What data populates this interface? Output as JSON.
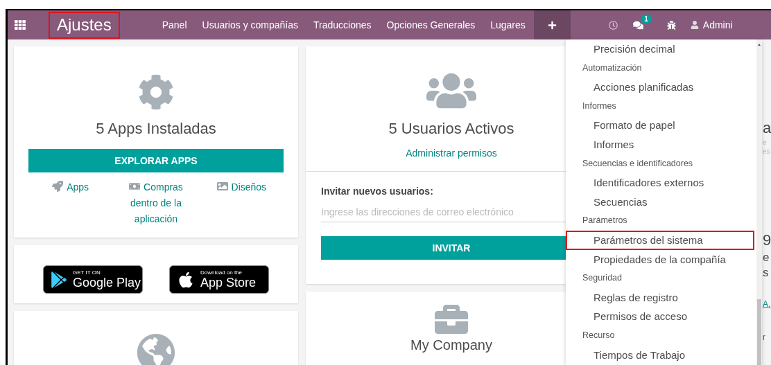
{
  "navbar": {
    "brand": {
      "label": "Ajustes",
      "highlighted": true
    },
    "menu": [
      {
        "label": "Panel"
      },
      {
        "label": "Usuarios y compañías"
      },
      {
        "label": "Traducciones"
      },
      {
        "label": "Opciones Generales"
      },
      {
        "label": "Lugares"
      }
    ],
    "add_menu_open": true,
    "messages_badge": "1",
    "user": "Admini"
  },
  "apps_card": {
    "title": "5 Apps Instaladas",
    "button": "EXPLORAR APPS",
    "links": [
      {
        "kind": "rocket",
        "label": "Apps"
      },
      {
        "kind": "money",
        "label": "Compras dentro de la aplicación"
      },
      {
        "kind": "image",
        "label": "Diseños"
      }
    ]
  },
  "store_card": {
    "google": {
      "top": "GET IT ON",
      "bottom": "Google Play"
    },
    "apple": {
      "top": "Download on the",
      "bottom": "App Store"
    }
  },
  "users_card": {
    "title": "5 Usuarios Activos",
    "link": "Administrar permisos",
    "invite_label": "Invitar nuevos usuarios:",
    "invite_placeholder": "Ingrese las direcciones de correo electrónico",
    "invite_button": "INVITAR"
  },
  "company_card": {
    "title": "My Company"
  },
  "right_column": [
    {
      "kind": "heading",
      "text": "a"
    },
    {
      "kind": "small",
      "text": "e"
    },
    {
      "kind": "small",
      "text": "es"
    },
    {
      "kind": "stat",
      "text": "9"
    },
    {
      "kind": "line",
      "text": "e"
    },
    {
      "kind": "line",
      "text": "s"
    },
    {
      "kind": "link",
      "text": "A."
    },
    {
      "kind": "link2",
      "text": "r"
    }
  ],
  "dropdown": [
    {
      "kind": "item",
      "label": "Precisión decimal",
      "highlighted": false
    },
    {
      "kind": "header",
      "label": "Automatización"
    },
    {
      "kind": "item",
      "label": "Acciones planificadas",
      "highlighted": false
    },
    {
      "kind": "header",
      "label": "Informes"
    },
    {
      "kind": "item",
      "label": "Formato de papel",
      "highlighted": false
    },
    {
      "kind": "item",
      "label": "Informes",
      "highlighted": false
    },
    {
      "kind": "header",
      "label": "Secuencias e identificadores"
    },
    {
      "kind": "item",
      "label": "Identificadores externos",
      "highlighted": false
    },
    {
      "kind": "item",
      "label": "Secuencias",
      "highlighted": false
    },
    {
      "kind": "header",
      "label": "Parámetros"
    },
    {
      "kind": "item",
      "label": "Parámetros del sistema",
      "highlighted": true
    },
    {
      "kind": "item",
      "label": "Propiedades de la compañía",
      "highlighted": false
    },
    {
      "kind": "header",
      "label": "Seguridad"
    },
    {
      "kind": "item",
      "label": "Reglas de registro",
      "highlighted": false
    },
    {
      "kind": "item",
      "label": "Permisos de acceso",
      "highlighted": false
    },
    {
      "kind": "header",
      "label": "Recurso"
    },
    {
      "kind": "item",
      "label": "Tiempos de Trabajo",
      "highlighted": false
    }
  ]
}
